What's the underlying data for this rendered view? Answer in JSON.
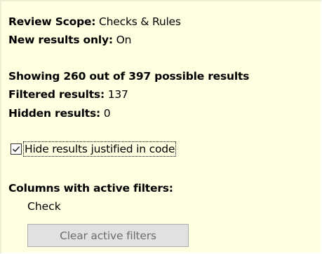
{
  "review_scope": {
    "label": "Review Scope:",
    "value": "Checks & Rules"
  },
  "new_results_only": {
    "label": "New results only:",
    "value": "On"
  },
  "showing_text": "Showing 260 out of 397 possible results",
  "filtered_results": {
    "label": "Filtered results:",
    "value": "137"
  },
  "hidden_results": {
    "label": "Hidden results:",
    "value": "0"
  },
  "hide_justified": {
    "label": "Hide results justified in code",
    "checked": true
  },
  "active_filters": {
    "heading": "Columns with active filters:",
    "columns": [
      "Check"
    ]
  },
  "clear_button_label": "Clear active filters",
  "colors": {
    "panel_background": "#ffffe1",
    "button_background": "#e1e1e1",
    "button_text_disabled": "#6d6d6d"
  }
}
